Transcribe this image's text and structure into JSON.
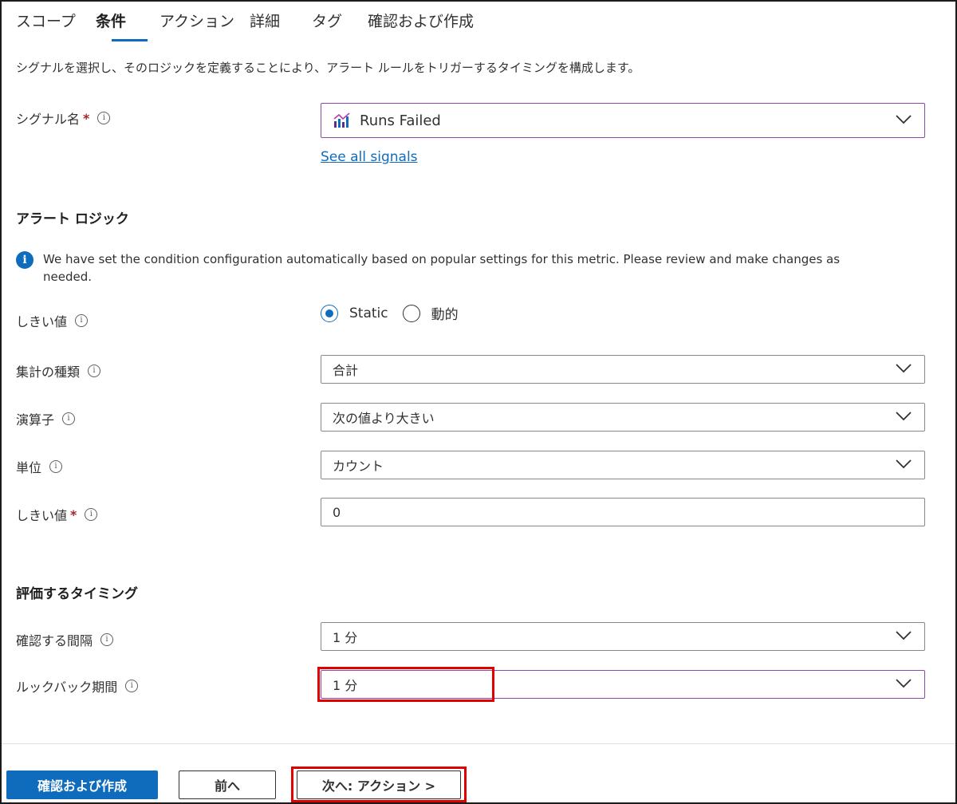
{
  "tabs": [
    {
      "label": "スコープ"
    },
    {
      "label": "条件"
    },
    {
      "label": "アクション"
    },
    {
      "label": "詳細"
    },
    {
      "label": "タグ"
    },
    {
      "label": "確認および作成"
    }
  ],
  "description": "シグナルを選択し、そのロジックを定義することにより、アラート ルールをトリガーするタイミングを構成します。",
  "signal": {
    "label": "シグナル名",
    "value": "Runs Failed",
    "link": "See all signals"
  },
  "alert_logic": {
    "title": "アラート ロジック",
    "info": "We have set the condition configuration automatically based on popular settings for this metric. Please review and make changes as needed.",
    "threshold_type": {
      "label": "しきい値",
      "options": [
        "Static",
        "動的"
      ],
      "selected": "Static"
    },
    "aggregation": {
      "label": "集計の種類",
      "value": "合計"
    },
    "operator": {
      "label": "演算子",
      "value": "次の値より大きい"
    },
    "unit": {
      "label": "単位",
      "value": "カウント"
    },
    "threshold_value": {
      "label": "しきい値",
      "value": "0"
    }
  },
  "evaluation": {
    "title": "評価するタイミング",
    "frequency": {
      "label": "確認する間隔",
      "value": "1 分"
    },
    "lookback": {
      "label": "ルックバック期間",
      "value": "1 分"
    }
  },
  "footer": {
    "review_create": "確認および作成",
    "previous": "前へ",
    "next": "次へ: アクション >"
  },
  "colors": {
    "accent": "#0f6cbd",
    "highlight": "#e00000",
    "focus_border": "#8c4aa8",
    "required": "#a4262c"
  }
}
